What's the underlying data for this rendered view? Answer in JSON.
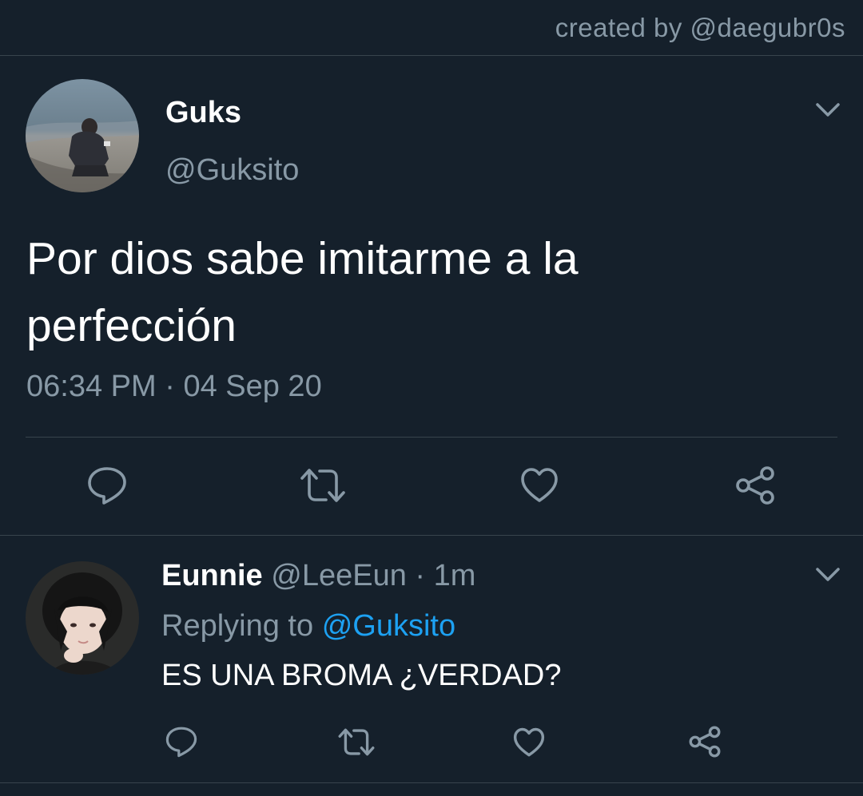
{
  "watermark": "created by @daegubr0s",
  "main_tweet": {
    "display_name": "Guks",
    "handle": "@Guksito",
    "text_line1": "Por dios sabe imitarme a la",
    "text_line2": "perfección",
    "time": "06:34 PM",
    "separator": "·",
    "date": "04 Sep 20",
    "actions": [
      "reply-icon",
      "retweet-icon",
      "like-icon",
      "share-icon"
    ]
  },
  "reply_tweet": {
    "display_name": "Eunnie",
    "handle": "@LeeEun",
    "separator": "·",
    "age": "1m",
    "replying_prefix": "Replying to",
    "replying_to": "@Guksito",
    "text": "ES UNA BROMA ¿VERDAD?",
    "actions": [
      "reply-icon",
      "retweet-icon",
      "like-icon",
      "share-icon"
    ]
  },
  "colors": {
    "background": "#15202b",
    "secondary_text": "#8899a6",
    "link": "#1da1f2",
    "divider": "#38444d"
  }
}
